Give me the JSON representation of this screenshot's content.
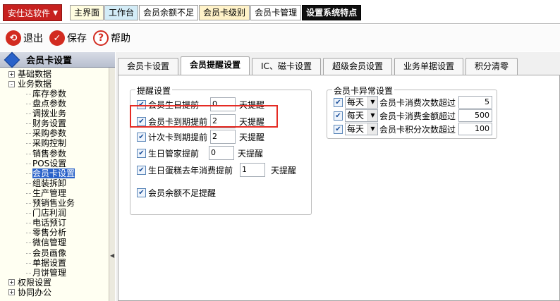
{
  "app": {
    "menu_label": "安仕达软件",
    "top_tabs": [
      {
        "label": "主界面"
      },
      {
        "label": "工作台"
      },
      {
        "label": "会员余额不足"
      },
      {
        "label": "会员卡级别"
      },
      {
        "label": "会员卡管理"
      },
      {
        "label": "设置系统特点"
      }
    ]
  },
  "toolbar": {
    "exit_label": "退出",
    "save_label": "保存",
    "help_label": "帮助"
  },
  "sidebar": {
    "title": "会员卡设置",
    "groups": [
      {
        "label": "基础数据",
        "expander": "+"
      },
      {
        "label": "业务数据",
        "expander": "-"
      }
    ],
    "items": [
      {
        "label": "库存参数"
      },
      {
        "label": "盘点参数"
      },
      {
        "label": "调拨业务"
      },
      {
        "label": "财务设置"
      },
      {
        "label": "采购参数"
      },
      {
        "label": "采购控制"
      },
      {
        "label": "销售参数"
      },
      {
        "label": "POS设置"
      },
      {
        "label": "会员卡设置",
        "selected": true
      },
      {
        "label": "组装拆卸"
      },
      {
        "label": "生产管理"
      },
      {
        "label": "预销售业务"
      },
      {
        "label": "门店利润"
      },
      {
        "label": "电话预订"
      },
      {
        "label": "零售分析"
      },
      {
        "label": "微信管理"
      },
      {
        "label": "会员画像"
      },
      {
        "label": "单据设置"
      },
      {
        "label": "月饼管理"
      }
    ],
    "bottom_groups": [
      {
        "label": "权限设置",
        "expander": "+"
      },
      {
        "label": "协同办公",
        "expander": "+"
      }
    ]
  },
  "main": {
    "tabs": [
      {
        "label": "会员卡设置"
      },
      {
        "label": "会员提醒设置"
      },
      {
        "label": "IC、磁卡设置"
      },
      {
        "label": "超级会员设置"
      },
      {
        "label": "业务单据设置"
      },
      {
        "label": "积分清零"
      }
    ],
    "reminder": {
      "legend": "提醒设置",
      "rows": [
        {
          "label": "会员生日提前",
          "value": "0",
          "suffix": "天提醒",
          "checked": true
        },
        {
          "label": "会员卡到期提前",
          "value": "2",
          "suffix": "天提醒",
          "checked": true
        },
        {
          "label": "计次卡到期提前",
          "value": "2",
          "suffix": "天提醒",
          "checked": true
        },
        {
          "label": "生日管家提前",
          "value": "0",
          "suffix": "天提醒",
          "checked": true
        },
        {
          "label": "生日蛋糕去年消费提前",
          "value": "1",
          "suffix": "天提醒",
          "checked": true
        }
      ],
      "balance_label": "会员余额不足提醒",
      "balance_checked": true
    },
    "abnormal": {
      "legend": "会员卡异常设置",
      "rows": [
        {
          "period": "每天",
          "label": "会员卡消费次数超过",
          "value": "5",
          "checked": true
        },
        {
          "period": "每天",
          "label": "会员卡消费金额超过",
          "value": "500",
          "checked": true
        },
        {
          "period": "每天",
          "label": "会员卡积分次数超过",
          "value": "100",
          "checked": true
        }
      ]
    }
  },
  "icons": {
    "exit": "exit-icon",
    "save": "check-icon",
    "help": "question-icon",
    "check": "✔",
    "dropdown": "▼"
  },
  "colors": {
    "brand_red": "#c7211f",
    "highlight_red": "#e52b24",
    "selected_blue": "#2a62c9"
  }
}
